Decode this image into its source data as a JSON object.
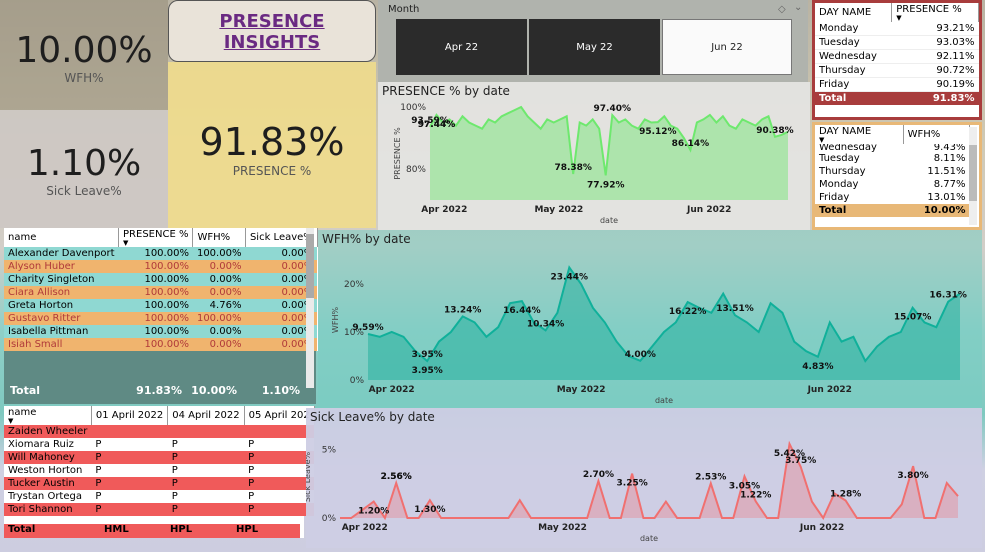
{
  "kpis": {
    "wfh_value": "10.00%",
    "wfh_label": "WFH%",
    "presence_value": "91.83%",
    "presence_label": "PRESENCE %",
    "sick_value": "1.10%",
    "sick_label": "Sick Leave%"
  },
  "title": "PRESENCE INSIGHTS",
  "month_slicer": {
    "label": "Month",
    "options": [
      "Apr 22",
      "May 22",
      "Jun 22"
    ],
    "selected": "Jun 22"
  },
  "day_presence_table": {
    "headers": [
      "DAY NAME",
      "PRESENCE %"
    ],
    "rows": [
      [
        "Monday",
        "93.21%"
      ],
      [
        "Tuesday",
        "93.03%"
      ],
      [
        "Wednesday",
        "92.11%"
      ],
      [
        "Thursday",
        "90.72%"
      ],
      [
        "Friday",
        "90.19%"
      ]
    ],
    "total": [
      "Total",
      "91.83%"
    ]
  },
  "day_wfh_table": {
    "headers": [
      "DAY NAME",
      "WFH%"
    ],
    "partial_row": [
      "Wednesday",
      "9.43%"
    ],
    "rows": [
      [
        "Tuesday",
        "8.11%"
      ],
      [
        "Thursday",
        "11.51%"
      ],
      [
        "Monday",
        "8.77%"
      ],
      [
        "Friday",
        "13.01%"
      ]
    ],
    "total": [
      "Total",
      "10.00%"
    ]
  },
  "employee_table": {
    "headers": [
      "name",
      "PRESENCE %",
      "WFH%",
      "Sick Leave%"
    ],
    "rows": [
      [
        "Alexander Davenport",
        "100.00%",
        "100.00%",
        "0.00%"
      ],
      [
        "Alyson Huber",
        "100.00%",
        "0.00%",
        "0.00%"
      ],
      [
        "Charity Singleton",
        "100.00%",
        "0.00%",
        "0.00%"
      ],
      [
        "Ciara Allison",
        "100.00%",
        "0.00%",
        "0.00%"
      ],
      [
        "Greta Horton",
        "100.00%",
        "4.76%",
        "0.00%"
      ],
      [
        "Gustavo Ritter",
        "100.00%",
        "100.00%",
        "0.00%"
      ],
      [
        "Isabella Pittman",
        "100.00%",
        "0.00%",
        "0.00%"
      ],
      [
        "Isiah Small",
        "100.00%",
        "0.00%",
        "0.00%"
      ]
    ],
    "total": [
      "Total",
      "91.83%",
      "10.00%",
      "1.10%"
    ]
  },
  "attendance_table": {
    "headers": [
      "name",
      "01 April 2022",
      "04 April 2022",
      "05 April 202"
    ],
    "rows": [
      [
        "Zaiden Wheeler",
        "",
        "",
        ""
      ],
      [
        "Xiomara Ruiz",
        "P",
        "P",
        "P"
      ],
      [
        "Will Mahoney",
        "P",
        "P",
        "P"
      ],
      [
        "Weston Horton",
        "P",
        "P",
        "P"
      ],
      [
        "Tucker Austin",
        "P",
        "P",
        "P"
      ],
      [
        "Trystan Ortega",
        "P",
        "P",
        "P"
      ],
      [
        "Tori Shannon",
        "P",
        "P",
        "P"
      ]
    ],
    "total": [
      "Total",
      "HML",
      "HPL",
      "HPL"
    ]
  },
  "chart_data": [
    {
      "type": "area",
      "title": "PRESENCE % by date",
      "xlabel": "date",
      "ylabel": "PRESENCE %",
      "x_ticks": [
        "Apr 2022",
        "May 2022",
        "Jun 2022"
      ],
      "y_ticks": [
        "80%",
        "100%"
      ],
      "ylim": [
        70,
        100
      ],
      "x": [
        "2022-04-01",
        "2022-04-04",
        "2022-04-05",
        "2022-04-06",
        "2022-04-07",
        "2022-04-08",
        "2022-04-11",
        "2022-04-12",
        "2022-04-13",
        "2022-04-14",
        "2022-04-15",
        "2022-04-18",
        "2022-04-19",
        "2022-04-20",
        "2022-04-21",
        "2022-04-22",
        "2022-04-25",
        "2022-04-26",
        "2022-04-27",
        "2022-04-28",
        "2022-04-29",
        "2022-05-02",
        "2022-05-03",
        "2022-05-04",
        "2022-05-05",
        "2022-05-06",
        "2022-05-09",
        "2022-05-10",
        "2022-05-11",
        "2022-05-12",
        "2022-05-13",
        "2022-05-16",
        "2022-05-17",
        "2022-05-18",
        "2022-05-19",
        "2022-05-20",
        "2022-05-23",
        "2022-05-24",
        "2022-05-25",
        "2022-05-26",
        "2022-05-27",
        "2022-05-30",
        "2022-05-31",
        "2022-06-01",
        "2022-06-02",
        "2022-06-03",
        "2022-06-06",
        "2022-06-07",
        "2022-06-08",
        "2022-06-09",
        "2022-06-10",
        "2022-06-13",
        "2022-06-14",
        "2022-06-15",
        "2022-06-16",
        "2022-06-17"
      ],
      "values": [
        93.59,
        97.44,
        95,
        96,
        94,
        97,
        95,
        94,
        93,
        96,
        95,
        97,
        98,
        99,
        100,
        97,
        95,
        93,
        96,
        95,
        96,
        97,
        78.38,
        95,
        94,
        96,
        93,
        77.92,
        97.4,
        95,
        96,
        94,
        93,
        96,
        95,
        95.12,
        97,
        94,
        93,
        90,
        86.14,
        95,
        96,
        97.44,
        95,
        97,
        94,
        93,
        96,
        95,
        94,
        96,
        97,
        90.38,
        91,
        92
      ],
      "labels": [
        "93.59%",
        "97.44%",
        "78.38%",
        "77.92%",
        "97.40%",
        "95.12%",
        "86.14%",
        "97.44%",
        "90.38%"
      ]
    },
    {
      "type": "area",
      "title": "WFH% by date",
      "xlabel": "date",
      "ylabel": "WFH%",
      "x_ticks": [
        "Apr 2022",
        "May 2022",
        "Jun 2022"
      ],
      "y_ticks": [
        "0%",
        "10%",
        "20%"
      ],
      "ylim": [
        0,
        25
      ],
      "values": [
        9.59,
        9,
        10,
        9,
        6,
        3.95,
        8,
        10,
        13.24,
        12,
        9,
        11,
        16,
        16.44,
        12,
        10.34,
        14,
        23.44,
        20,
        15,
        12,
        8,
        5,
        4,
        7,
        10,
        12,
        16.22,
        15,
        14,
        18,
        13.51,
        12,
        10,
        16,
        14,
        8,
        6,
        4.83,
        12,
        8,
        9,
        3.95,
        7,
        9,
        10,
        15.07,
        12,
        11,
        16.31,
        18
      ],
      "labels": [
        "9.59%",
        "3.95%",
        "13.24%",
        "16.44%",
        "10.34%",
        "23.44%",
        "4.00%",
        "16.22%",
        "13.51%",
        "4.83%",
        "3.95%",
        "15.07%",
        "16.31%"
      ]
    },
    {
      "type": "area",
      "title": "Sick Leave% by date",
      "xlabel": "date",
      "ylabel": "Sick Leave%",
      "x_ticks": [
        "Apr 2022",
        "May 2022",
        "Jun 2022"
      ],
      "y_ticks": [
        "0%",
        "5%"
      ],
      "ylim": [
        0,
        6
      ],
      "values": [
        0,
        0,
        0.6,
        1.2,
        0,
        2.56,
        0,
        0,
        1.3,
        0,
        0,
        0,
        0,
        0,
        0,
        0,
        1.3,
        0,
        0,
        0,
        0,
        0,
        0,
        2.7,
        0,
        0,
        3.25,
        0,
        0,
        1.2,
        0,
        0,
        0,
        2.53,
        0,
        0,
        3.05,
        1.22,
        0,
        0,
        5.42,
        3.75,
        1.2,
        0,
        1.8,
        1.28,
        0,
        0,
        0,
        0,
        1,
        3.8,
        0,
        0,
        2.56,
        1.6
      ],
      "labels": [
        "2.56%",
        "1.30%",
        "2.70%",
        "3.25%",
        "2.53%",
        "3.05%",
        "1.22%",
        "5.42%",
        "3.75%",
        "1.20%",
        "1.28%",
        "3.80%",
        "2.56%"
      ]
    }
  ]
}
